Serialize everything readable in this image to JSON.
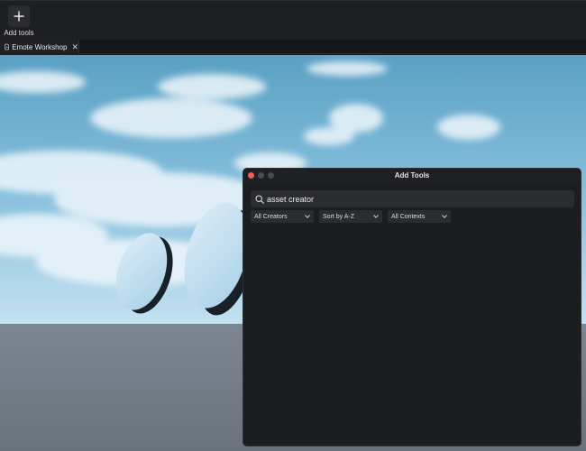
{
  "toolbar": {
    "add_tools_label": "Add tools"
  },
  "tabs": [
    {
      "label": "Emote Workshop",
      "icon": "document-icon",
      "close": "✕"
    }
  ],
  "dialog": {
    "title": "Add Tools",
    "search": {
      "value": "asset creator",
      "icon": "search-icon"
    },
    "filters": [
      {
        "label": "All Creators",
        "icon": "chevron-down-icon"
      },
      {
        "label": "Sort by A-Z",
        "icon": "chevron-down-icon"
      },
      {
        "label": "All Contexts",
        "icon": "chevron-down-icon"
      }
    ]
  },
  "colors": {
    "accent_close": "#ee5f56",
    "sky_top": "#5fa3c6",
    "sky_horizon": "#b9dcef",
    "ground": "#6f7782",
    "dialog_bg": "#1c1d21"
  }
}
